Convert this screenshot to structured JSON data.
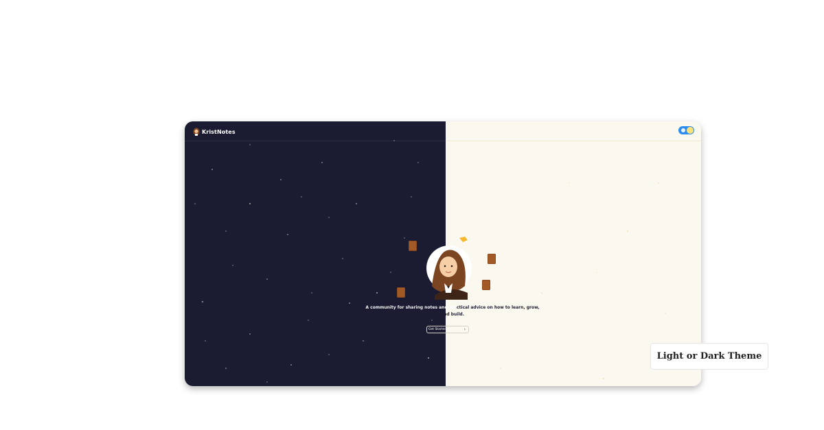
{
  "header": {
    "brand_name": "KristNotes",
    "brand_logo_icon": "avatar-logo-icon",
    "theme_toggle_icon": "theme-toggle-icon"
  },
  "hero": {
    "tagline": "A community for sharing notes and practical advice on how to learn, grow, and build.",
    "cta_label": "Get Started",
    "cta_icon": "chevron-right-icon"
  },
  "caption": {
    "label": "Light or Dark Theme"
  },
  "colors": {
    "dark_bg": "#1b1b31",
    "light_bg": "#fbf8f0",
    "toggle_accent": "#2d8cf0",
    "book_brown": "#8a4b1e",
    "pencil_yellow": "#f5b82e"
  }
}
